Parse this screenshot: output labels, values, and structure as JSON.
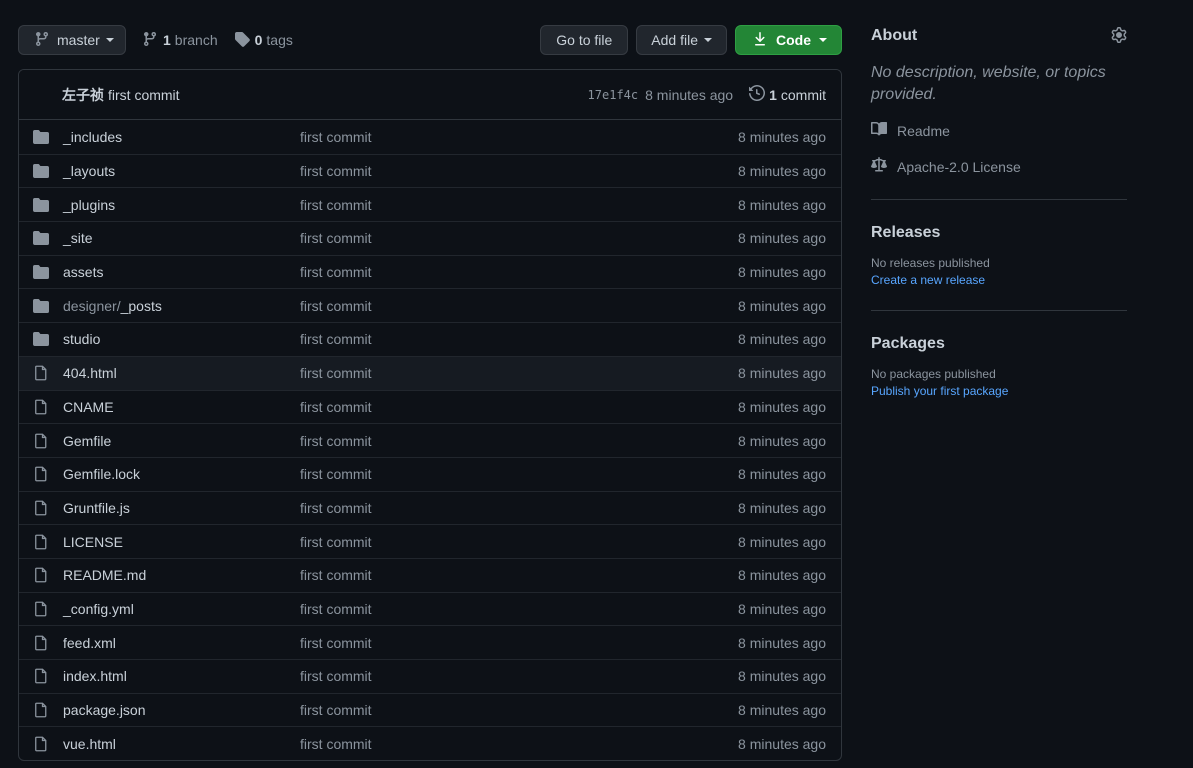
{
  "toolbar": {
    "branch_name": "master",
    "branch_count": "1",
    "branch_word": "branch",
    "tag_count": "0",
    "tag_word": "tags",
    "go_to_file": "Go to file",
    "add_file": "Add file",
    "code": "Code"
  },
  "latest_commit": {
    "author": "左子祯",
    "message": "first commit",
    "sha": "17e1f4c",
    "time": "8 minutes ago",
    "count": "1",
    "count_word": "commit"
  },
  "files": [
    {
      "prefix": "",
      "name": "_includes",
      "type": "folder",
      "message": "first commit",
      "age": "8 minutes ago"
    },
    {
      "prefix": "",
      "name": "_layouts",
      "type": "folder",
      "message": "first commit",
      "age": "8 minutes ago"
    },
    {
      "prefix": "",
      "name": "_plugins",
      "type": "folder",
      "message": "first commit",
      "age": "8 minutes ago"
    },
    {
      "prefix": "",
      "name": "_site",
      "type": "folder",
      "message": "first commit",
      "age": "8 minutes ago"
    },
    {
      "prefix": "",
      "name": "assets",
      "type": "folder",
      "message": "first commit",
      "age": "8 minutes ago"
    },
    {
      "prefix": "designer/",
      "name": "_posts",
      "type": "folder",
      "message": "first commit",
      "age": "8 minutes ago"
    },
    {
      "prefix": "",
      "name": "studio",
      "type": "folder",
      "message": "first commit",
      "age": "8 minutes ago"
    },
    {
      "prefix": "",
      "name": "404.html",
      "type": "file",
      "message": "first commit",
      "age": "8 minutes ago"
    },
    {
      "prefix": "",
      "name": "CNAME",
      "type": "file",
      "message": "first commit",
      "age": "8 minutes ago"
    },
    {
      "prefix": "",
      "name": "Gemfile",
      "type": "file",
      "message": "first commit",
      "age": "8 minutes ago"
    },
    {
      "prefix": "",
      "name": "Gemfile.lock",
      "type": "file",
      "message": "first commit",
      "age": "8 minutes ago"
    },
    {
      "prefix": "",
      "name": "Gruntfile.js",
      "type": "file",
      "message": "first commit",
      "age": "8 minutes ago"
    },
    {
      "prefix": "",
      "name": "LICENSE",
      "type": "file",
      "message": "first commit",
      "age": "8 minutes ago"
    },
    {
      "prefix": "",
      "name": "README.md",
      "type": "file",
      "message": "first commit",
      "age": "8 minutes ago"
    },
    {
      "prefix": "",
      "name": "_config.yml",
      "type": "file",
      "message": "first commit",
      "age": "8 minutes ago"
    },
    {
      "prefix": "",
      "name": "feed.xml",
      "type": "file",
      "message": "first commit",
      "age": "8 minutes ago"
    },
    {
      "prefix": "",
      "name": "index.html",
      "type": "file",
      "message": "first commit",
      "age": "8 minutes ago"
    },
    {
      "prefix": "",
      "name": "package.json",
      "type": "file",
      "message": "first commit",
      "age": "8 minutes ago"
    },
    {
      "prefix": "",
      "name": "vue.html",
      "type": "file",
      "message": "first commit",
      "age": "8 minutes ago"
    }
  ],
  "highlighted_row": 7,
  "about": {
    "title": "About",
    "description": "No description, website, or topics provided.",
    "readme": "Readme",
    "license": "Apache-2.0 License"
  },
  "releases": {
    "title": "Releases",
    "status": "No releases published",
    "link": "Create a new release"
  },
  "packages": {
    "title": "Packages",
    "status": "No packages published",
    "link": "Publish your first package"
  },
  "colors": {
    "background": "#0d1117",
    "border": "#30363d",
    "code_button": "#238636",
    "link": "#58a6ff"
  }
}
